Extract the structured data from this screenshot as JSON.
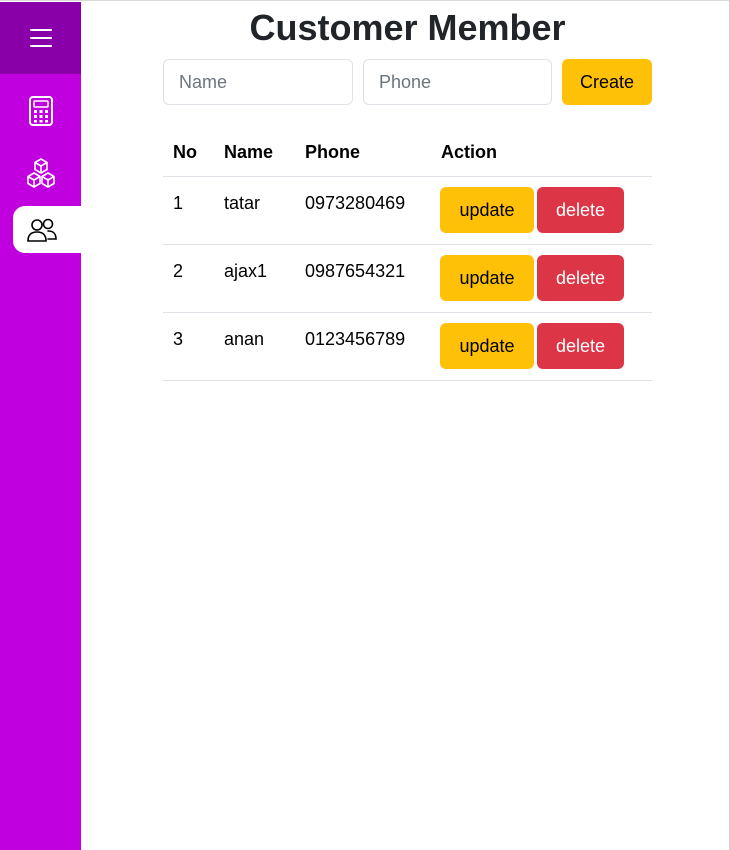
{
  "sidebar": {
    "menu_icon": "hamburger-menu-icon",
    "items": [
      {
        "icon": "calculator-icon",
        "active": false
      },
      {
        "icon": "boxes-icon",
        "active": false
      },
      {
        "icon": "people-icon",
        "active": true
      }
    ]
  },
  "page": {
    "title": "Customer Member"
  },
  "form": {
    "name_placeholder": "Name",
    "phone_placeholder": "Phone",
    "name_value": "",
    "phone_value": "",
    "create_label": "Create"
  },
  "table": {
    "headers": {
      "no": "No",
      "name": "Name",
      "phone": "Phone",
      "action": "Action"
    },
    "rows": [
      {
        "no": "1",
        "name": "tatar",
        "phone": "0973280469",
        "update_label": "update",
        "delete_label": "delete"
      },
      {
        "no": "2",
        "name": "ajax1",
        "phone": "0987654321",
        "update_label": "update",
        "delete_label": "delete"
      },
      {
        "no": "3",
        "name": "anan",
        "phone": "0123456789",
        "update_label": "update",
        "delete_label": "delete"
      }
    ]
  },
  "colors": {
    "sidebar": "#c000df",
    "sidebar_header": "#8a00a8",
    "warning": "#ffc107",
    "danger": "#dc3545"
  }
}
